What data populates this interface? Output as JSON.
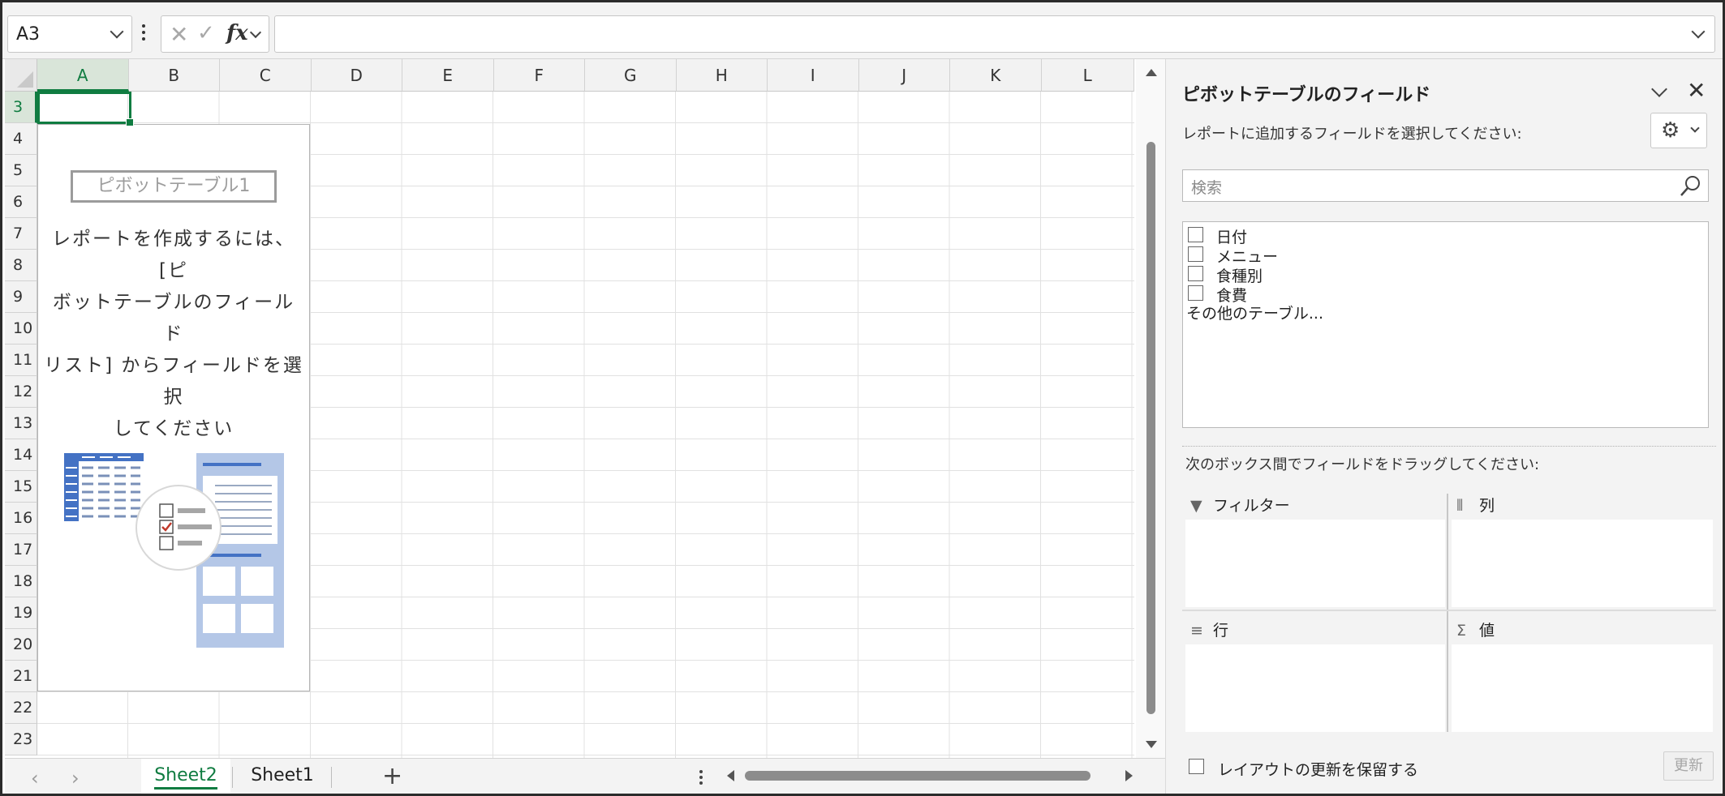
{
  "formula_bar": {
    "name_box": "A3",
    "cancel_glyph": "✕",
    "enter_glyph": "✓",
    "function_label": "fx",
    "formula": ""
  },
  "grid": {
    "columns": [
      "A",
      "B",
      "C",
      "D",
      "E",
      "F",
      "G",
      "H",
      "I",
      "J",
      "K",
      "L"
    ],
    "rows": [
      "3",
      "4",
      "5",
      "6",
      "7",
      "8",
      "9",
      "10",
      "11",
      "12",
      "13",
      "14",
      "15",
      "16",
      "17",
      "18",
      "19",
      "20",
      "21",
      "22",
      "23"
    ],
    "selected_column": "A",
    "selected_row": "3"
  },
  "pivot_placeholder": {
    "name": "ピボットテーブル1",
    "message_lines": [
      "レポートを作成するには、[ピ",
      "ボットテーブルのフィールド",
      "リスト] からフィールドを選択",
      "してください"
    ],
    "accent_color": "#4472c4",
    "check_color": "#c0392b"
  },
  "sheet_tabs": {
    "tabs": [
      {
        "label": "Sheet2",
        "active": true
      },
      {
        "label": "Sheet1",
        "active": false
      }
    ],
    "add_glyph": "+",
    "prev_glyph": "‹",
    "next_glyph": "›"
  },
  "pane": {
    "title": "ピボットテーブルのフィールド",
    "collapse_icon": "chevron-down-icon",
    "close_glyph": "✕",
    "subtitle": "レポートに追加するフィールドを選択してください:",
    "gear_glyph": "⚙",
    "search_placeholder": "検索",
    "fields": [
      {
        "label": "日付",
        "checked": false
      },
      {
        "label": "メニュー",
        "checked": false
      },
      {
        "label": "食種別",
        "checked": false
      },
      {
        "label": "食費",
        "checked": false
      }
    ],
    "more_tables": "その他のテーブル...",
    "drag_message": "次のボックス間でフィールドをドラッグしてください:",
    "areas": {
      "filter": {
        "icon_glyph": "▼",
        "label": "フィルター"
      },
      "columns": {
        "icon_glyph": "⦀",
        "label": "列"
      },
      "rows": {
        "icon_glyph": "≡",
        "label": "行"
      },
      "values": {
        "icon_glyph": "Σ",
        "label": "値"
      }
    },
    "defer_label": "レイアウトの更新を保留する",
    "update_button": "更新"
  },
  "colors": {
    "excel_green": "#107c41",
    "pane_background": "#f3f3f3"
  }
}
